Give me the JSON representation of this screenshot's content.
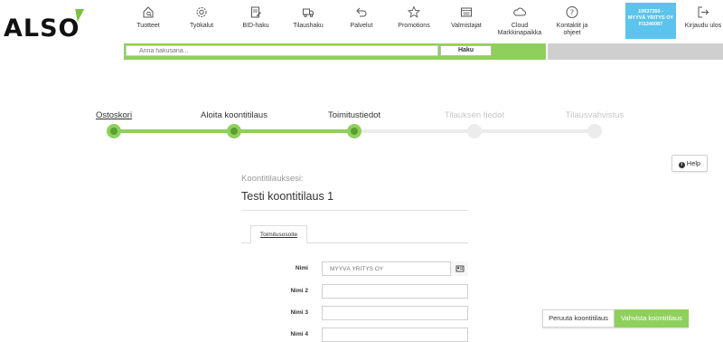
{
  "brand": {
    "logo_text": "ALSO",
    "accent": "#7ac142",
    "primary_green": "#8fd05d",
    "account_blue": "#5cc3ec"
  },
  "nav": {
    "products": "Tuotteet",
    "tools": "Työkalut",
    "bid": "BID-haku",
    "order_search": "Tilaushaku",
    "services": "Palvelut",
    "promotions": "Promotions",
    "manufacturers": "Valmistajat",
    "cloud": [
      "Cloud",
      "Markkinapaikka"
    ],
    "contacts": [
      "Kontaktit ja",
      "ohjeet"
    ],
    "account": [
      "10637350 -",
      "MYYVÄ YRITYS OY",
      "FI1340087"
    ],
    "logout": "Kirjaudu ulos"
  },
  "search": {
    "placeholder": "Anna hakusana...",
    "button": "Haku"
  },
  "steps": [
    {
      "label": "Ostoskori",
      "state": "done"
    },
    {
      "label": "Aloita koontitilaus",
      "state": "done"
    },
    {
      "label": "Toimitustiedot",
      "state": "current"
    },
    {
      "label": "Tilauksen tiedot",
      "state": "todo"
    },
    {
      "label": "Tilausvahvistus",
      "state": "todo"
    }
  ],
  "help": {
    "label": "Help"
  },
  "form": {
    "caption": "Koontitilauksesi:",
    "title": "Testi koontitilaus 1",
    "tab": "Toimitusosoite",
    "fields": [
      {
        "label": "Nimi",
        "value": "MYYVÄ YRITYS OY"
      },
      {
        "label": "Nimi 2",
        "value": ""
      },
      {
        "label": "Nimi 3",
        "value": ""
      },
      {
        "label": "Nimi 4",
        "value": ""
      }
    ]
  },
  "actions": {
    "cancel": "Peruuta koontitilaus",
    "confirm": "Vahvista koontitilaus"
  }
}
